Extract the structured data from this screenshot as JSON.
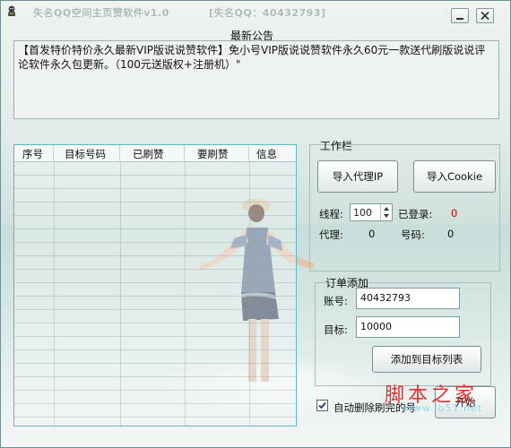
{
  "window": {
    "title": "失名QQ空间主页赞软件v1.0",
    "qq_label": "[失名QQ：40432793]"
  },
  "notice": {
    "title": "最新公告",
    "text": "【首发特价特价永久最新VIP版说说赞软件】免小号VIP版说说赞软件永久60元一款送代刷版说说评论软件永久包更新。（100元送版权+注册机）\""
  },
  "list": {
    "columns": [
      "序号",
      "目标号码",
      "已刷赞",
      "要刷赞",
      "信息"
    ]
  },
  "work": {
    "group_title": "工作栏",
    "import_proxy": "导入代理IP",
    "import_cookie": "导入Cookie",
    "threads_label": "线程:",
    "threads_value": "100",
    "logged_label": "已登录:",
    "logged_value": "0",
    "proxy_label": "代理:",
    "proxy_value": "0",
    "account_count_label": "号码:",
    "account_count_value": "0"
  },
  "order": {
    "group_title": "订单添加",
    "account_label": "账号:",
    "account_value": "40432793",
    "target_label": "目标:",
    "target_value": "10000",
    "add_button": "添加到目标列表"
  },
  "footer": {
    "auto_delete_label": "自动删除刷完的号",
    "auto_delete_checked": true,
    "start_button": "开始"
  },
  "watermark": {
    "cn": "脚本之家",
    "url": "www.jb51.net"
  }
}
